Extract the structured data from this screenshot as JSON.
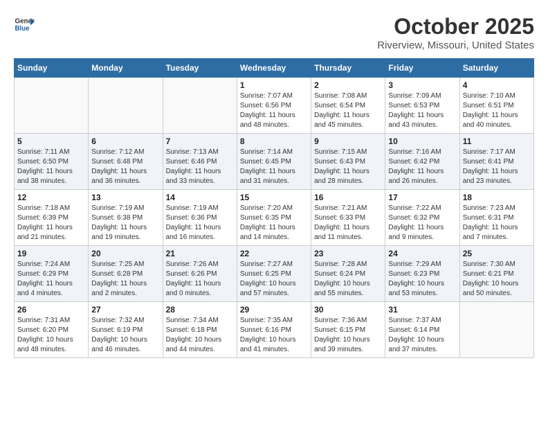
{
  "header": {
    "logo_line1": "General",
    "logo_line2": "Blue",
    "month": "October 2025",
    "location": "Riverview, Missouri, United States"
  },
  "days_of_week": [
    "Sunday",
    "Monday",
    "Tuesday",
    "Wednesday",
    "Thursday",
    "Friday",
    "Saturday"
  ],
  "weeks": [
    [
      {
        "day": "",
        "info": ""
      },
      {
        "day": "",
        "info": ""
      },
      {
        "day": "",
        "info": ""
      },
      {
        "day": "1",
        "info": "Sunrise: 7:07 AM\nSunset: 6:56 PM\nDaylight: 11 hours and 48 minutes."
      },
      {
        "day": "2",
        "info": "Sunrise: 7:08 AM\nSunset: 6:54 PM\nDaylight: 11 hours and 45 minutes."
      },
      {
        "day": "3",
        "info": "Sunrise: 7:09 AM\nSunset: 6:53 PM\nDaylight: 11 hours and 43 minutes."
      },
      {
        "day": "4",
        "info": "Sunrise: 7:10 AM\nSunset: 6:51 PM\nDaylight: 11 hours and 40 minutes."
      }
    ],
    [
      {
        "day": "5",
        "info": "Sunrise: 7:11 AM\nSunset: 6:50 PM\nDaylight: 11 hours and 38 minutes."
      },
      {
        "day": "6",
        "info": "Sunrise: 7:12 AM\nSunset: 6:48 PM\nDaylight: 11 hours and 36 minutes."
      },
      {
        "day": "7",
        "info": "Sunrise: 7:13 AM\nSunset: 6:46 PM\nDaylight: 11 hours and 33 minutes."
      },
      {
        "day": "8",
        "info": "Sunrise: 7:14 AM\nSunset: 6:45 PM\nDaylight: 11 hours and 31 minutes."
      },
      {
        "day": "9",
        "info": "Sunrise: 7:15 AM\nSunset: 6:43 PM\nDaylight: 11 hours and 28 minutes."
      },
      {
        "day": "10",
        "info": "Sunrise: 7:16 AM\nSunset: 6:42 PM\nDaylight: 11 hours and 26 minutes."
      },
      {
        "day": "11",
        "info": "Sunrise: 7:17 AM\nSunset: 6:41 PM\nDaylight: 11 hours and 23 minutes."
      }
    ],
    [
      {
        "day": "12",
        "info": "Sunrise: 7:18 AM\nSunset: 6:39 PM\nDaylight: 11 hours and 21 minutes."
      },
      {
        "day": "13",
        "info": "Sunrise: 7:19 AM\nSunset: 6:38 PM\nDaylight: 11 hours and 19 minutes."
      },
      {
        "day": "14",
        "info": "Sunrise: 7:19 AM\nSunset: 6:36 PM\nDaylight: 11 hours and 16 minutes."
      },
      {
        "day": "15",
        "info": "Sunrise: 7:20 AM\nSunset: 6:35 PM\nDaylight: 11 hours and 14 minutes."
      },
      {
        "day": "16",
        "info": "Sunrise: 7:21 AM\nSunset: 6:33 PM\nDaylight: 11 hours and 11 minutes."
      },
      {
        "day": "17",
        "info": "Sunrise: 7:22 AM\nSunset: 6:32 PM\nDaylight: 11 hours and 9 minutes."
      },
      {
        "day": "18",
        "info": "Sunrise: 7:23 AM\nSunset: 6:31 PM\nDaylight: 11 hours and 7 minutes."
      }
    ],
    [
      {
        "day": "19",
        "info": "Sunrise: 7:24 AM\nSunset: 6:29 PM\nDaylight: 11 hours and 4 minutes."
      },
      {
        "day": "20",
        "info": "Sunrise: 7:25 AM\nSunset: 6:28 PM\nDaylight: 11 hours and 2 minutes."
      },
      {
        "day": "21",
        "info": "Sunrise: 7:26 AM\nSunset: 6:26 PM\nDaylight: 11 hours and 0 minutes."
      },
      {
        "day": "22",
        "info": "Sunrise: 7:27 AM\nSunset: 6:25 PM\nDaylight: 10 hours and 57 minutes."
      },
      {
        "day": "23",
        "info": "Sunrise: 7:28 AM\nSunset: 6:24 PM\nDaylight: 10 hours and 55 minutes."
      },
      {
        "day": "24",
        "info": "Sunrise: 7:29 AM\nSunset: 6:23 PM\nDaylight: 10 hours and 53 minutes."
      },
      {
        "day": "25",
        "info": "Sunrise: 7:30 AM\nSunset: 6:21 PM\nDaylight: 10 hours and 50 minutes."
      }
    ],
    [
      {
        "day": "26",
        "info": "Sunrise: 7:31 AM\nSunset: 6:20 PM\nDaylight: 10 hours and 48 minutes."
      },
      {
        "day": "27",
        "info": "Sunrise: 7:32 AM\nSunset: 6:19 PM\nDaylight: 10 hours and 46 minutes."
      },
      {
        "day": "28",
        "info": "Sunrise: 7:34 AM\nSunset: 6:18 PM\nDaylight: 10 hours and 44 minutes."
      },
      {
        "day": "29",
        "info": "Sunrise: 7:35 AM\nSunset: 6:16 PM\nDaylight: 10 hours and 41 minutes."
      },
      {
        "day": "30",
        "info": "Sunrise: 7:36 AM\nSunset: 6:15 PM\nDaylight: 10 hours and 39 minutes."
      },
      {
        "day": "31",
        "info": "Sunrise: 7:37 AM\nSunset: 6:14 PM\nDaylight: 10 hours and 37 minutes."
      },
      {
        "day": "",
        "info": ""
      }
    ]
  ]
}
